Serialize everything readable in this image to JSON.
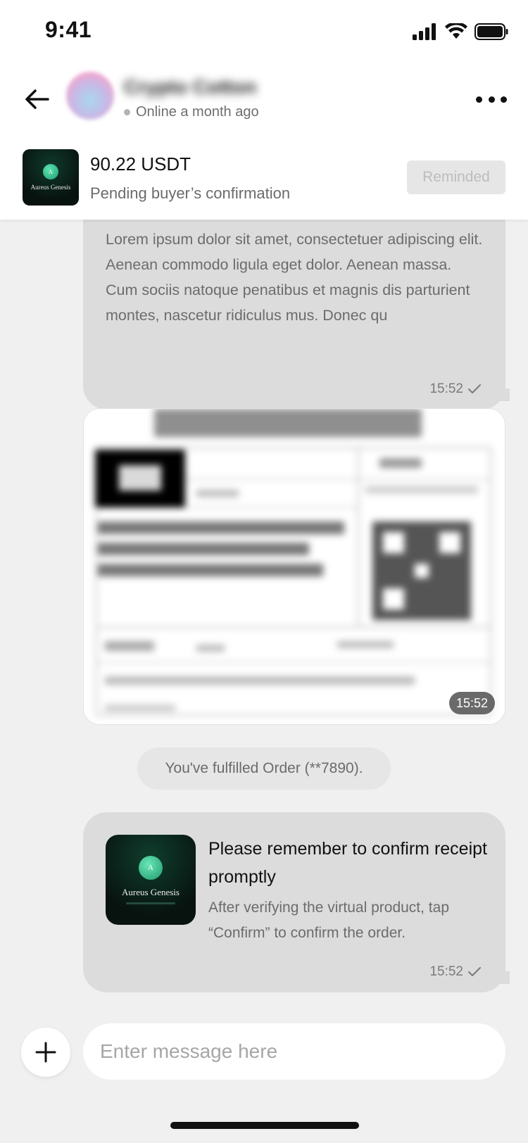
{
  "status_bar": {
    "time": "9:41"
  },
  "header": {
    "user_name": "Crypto Cotton",
    "online_status": "Online a month ago"
  },
  "order": {
    "thumb_title": "Aureus Genesis",
    "thumb_letter": "A",
    "price": "90.22 USDT",
    "status": "Pending buyer’s confirmation",
    "reminded_label": "Reminded"
  },
  "messages": {
    "text_message": {
      "body": "Lorem ipsum dolor sit amet, consectetuer adipiscing elit. Aenean commodo ligula eget dolor. Aenean massa. Cum sociis natoque penatibus et magnis dis parturient montes, nascetur ridiculus mus. Donec qu",
      "time": "15:52"
    },
    "image_message": {
      "time": "15:52"
    },
    "system_notice": "You've fulfilled Order (**7890).",
    "card_message": {
      "thumb_title": "Aureus Genesis",
      "thumb_letter": "A",
      "title": "Please remember to confirm receipt promptly",
      "description": "After verifying the virtual product, tap “Confirm” to confirm the order.",
      "time": "15:52"
    }
  },
  "composer": {
    "placeholder": "Enter message here"
  },
  "colors": {
    "background": "#f0f0f0",
    "bubble": "#dcdcdc",
    "product_dark": "#08130f",
    "product_accent": "#1f9f72"
  }
}
